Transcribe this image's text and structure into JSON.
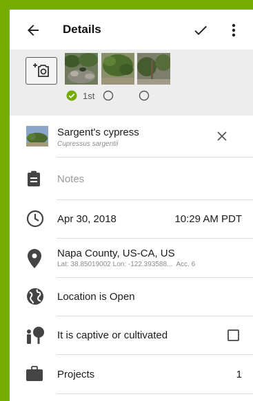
{
  "appbar": {
    "title": "Details",
    "icons": {
      "back": "arrow-left-icon",
      "save": "check-icon",
      "menu": "more-vertical-icon"
    }
  },
  "photos": {
    "first_label": "1st",
    "count": 3
  },
  "taxon": {
    "common_name": "Sargent's cypress",
    "scientific_name": "Cupressus sargentii"
  },
  "notes": {
    "placeholder": "Notes"
  },
  "datetime": {
    "date": "Apr 30, 2018",
    "time": "10:29 AM PDT"
  },
  "location": {
    "place": "Napa County, US-CA, US",
    "coords": "Lat: 38.85019002 Lon: -122.393588...  Acc. 6"
  },
  "geoprivacy": {
    "label": "Location is Open"
  },
  "captive": {
    "label": "It is captive or cultivated",
    "checked": false
  },
  "projects": {
    "label": "Projects",
    "count": "1"
  },
  "colors": {
    "brand_green": "#74ac00",
    "check_green": "#74ac00"
  }
}
